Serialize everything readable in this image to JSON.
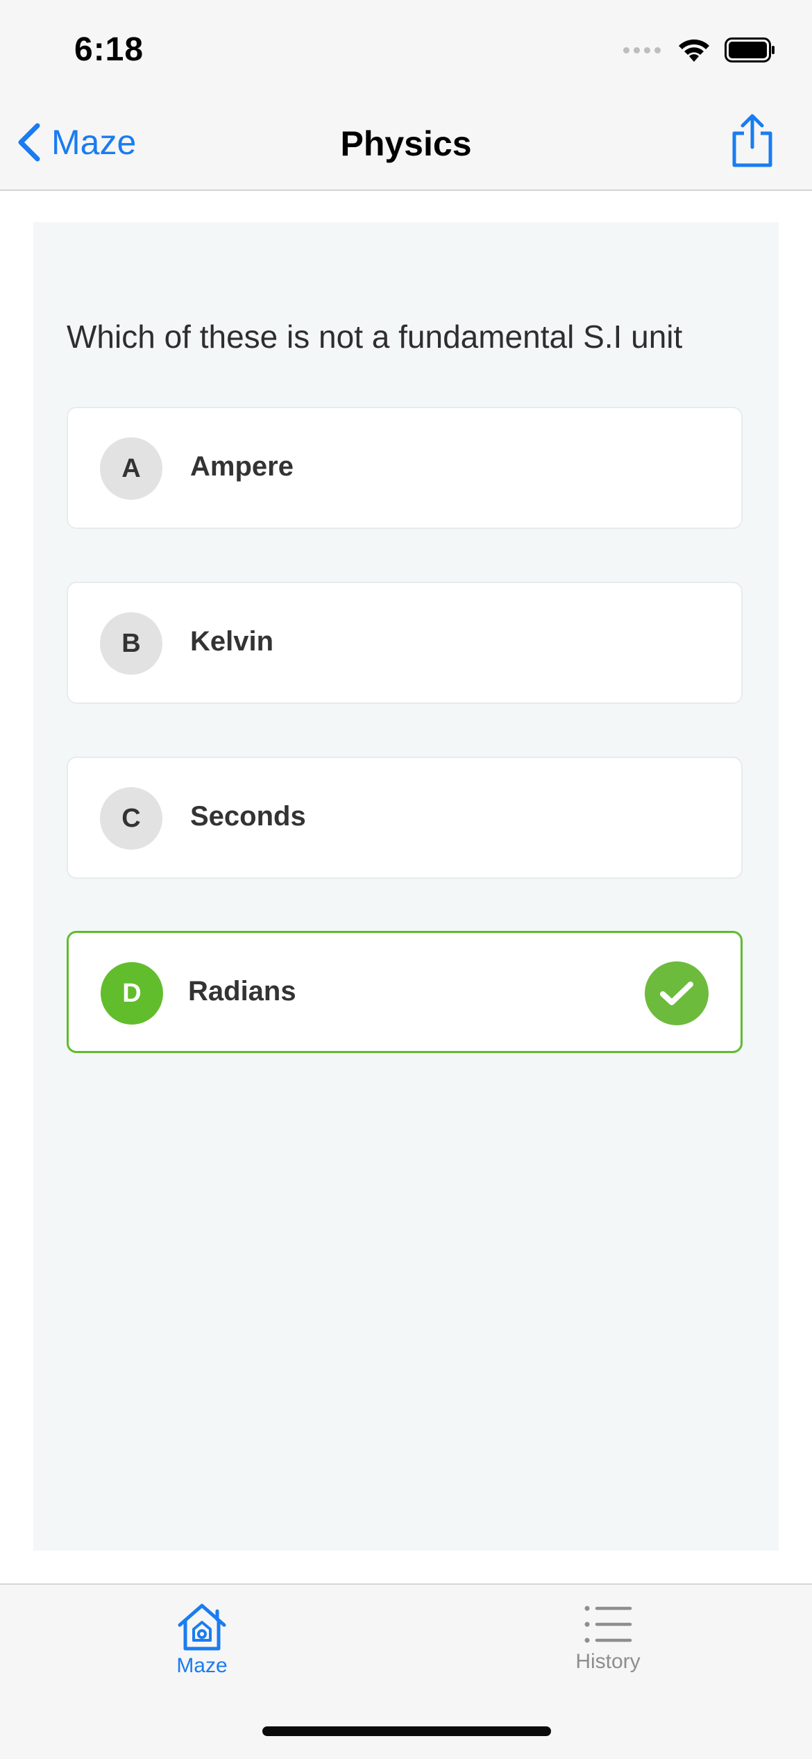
{
  "status_bar": {
    "time": "6:18",
    "icons": [
      "cellular-signal-icon",
      "wifi-icon",
      "battery-icon"
    ]
  },
  "nav": {
    "back_label": "Maze",
    "title": "Physics",
    "share_icon": "share-icon"
  },
  "quiz": {
    "question": "Which of these is not a fundamental S.I unit",
    "options": [
      {
        "letter": "A",
        "label": "Ampere",
        "correct": false
      },
      {
        "letter": "B",
        "label": "Kelvin",
        "correct": false
      },
      {
        "letter": "C",
        "label": "Seconds",
        "correct": false
      },
      {
        "letter": "D",
        "label": "Radians",
        "correct": true
      }
    ]
  },
  "tabs": [
    {
      "label": "Maze",
      "icon": "home-icon",
      "active": true
    },
    {
      "label": "History",
      "icon": "list-icon",
      "active": false
    }
  ],
  "colors": {
    "accent": "#1a7cf0",
    "correct": "#62bd2c",
    "panel_bg": "#f3f7f7",
    "bar_bg": "#f6f6f6"
  }
}
